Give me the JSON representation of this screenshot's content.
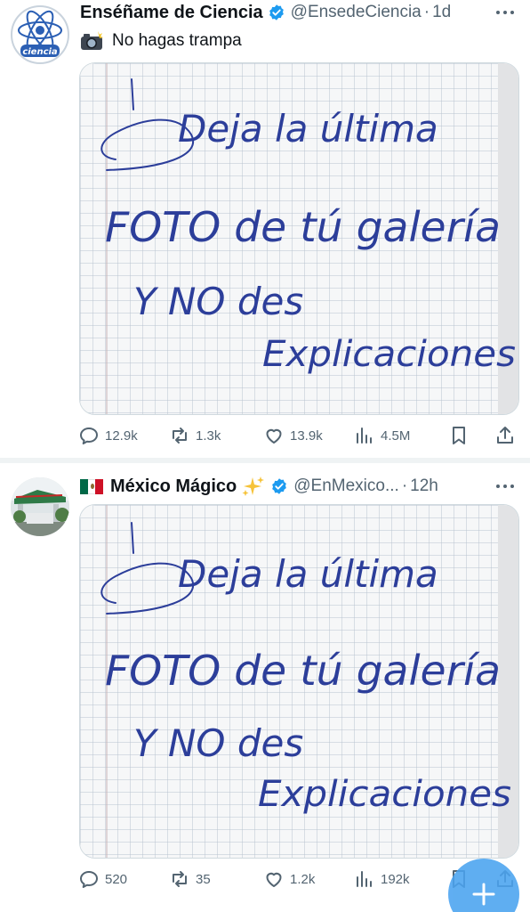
{
  "tweets": [
    {
      "name": "Enséñame de Ciencia",
      "handle": "@EnsedeCiencia",
      "separator": "·",
      "time": "1d",
      "avatar_icon": "science-atom-logo",
      "avatar_text": "ciencia",
      "text_icon": "camera-flash-emoji",
      "text": "No hagas trampa",
      "image_text": [
        "Deja la última",
        "FOTO de tú galería",
        "Y NO des",
        "Explicaciones"
      ],
      "stats": {
        "replies": "12.9k",
        "retweets": "1.3k",
        "likes": "13.9k",
        "views": "4.5M"
      }
    },
    {
      "name": "México Mágico",
      "flag_icon": "mexico-flag-emoji",
      "name_icon": "sparkles-emoji",
      "handle": "@EnMexico...",
      "separator": "·",
      "time": "12h",
      "avatar_icon": "photo-avatar",
      "image_text": [
        "Deja la última",
        "FOTO de tú galería",
        "Y NO des",
        "Explicaciones"
      ],
      "stats": {
        "replies": "520",
        "retweets": "35",
        "likes": "1.2k",
        "views": "192k"
      }
    }
  ],
  "colors": {
    "verified_badge": "#1d9bf0",
    "secondary_text": "#536471",
    "ink_blue": "#2c3e9a",
    "fab_blue": "#4aa3f0",
    "mexico_green": "#006847",
    "mexico_red": "#ce1126"
  },
  "icons": [
    "reply-icon",
    "retweet-icon",
    "like-icon",
    "views-icon",
    "bookmark-icon",
    "share-icon",
    "more-icon",
    "verified-icon",
    "compose-plus-icon"
  ]
}
